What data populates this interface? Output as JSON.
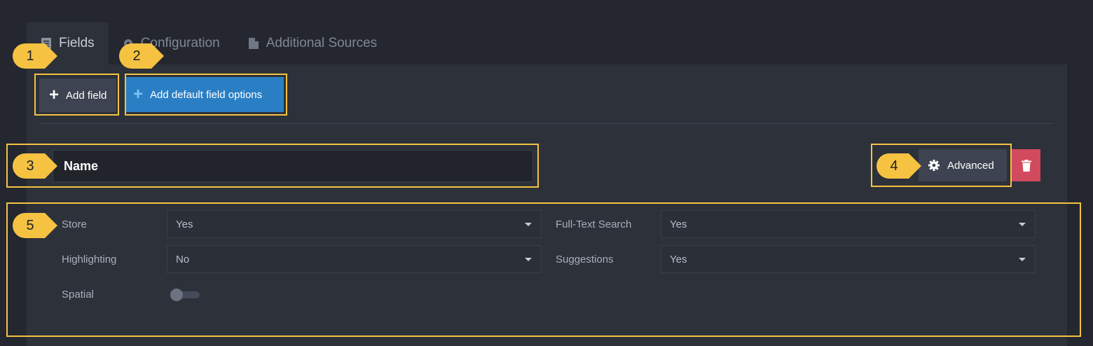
{
  "tabs": [
    {
      "label": "Fields",
      "icon": "list-icon",
      "active": true
    },
    {
      "label": "Configuration",
      "icon": "gear-icon",
      "active": false
    },
    {
      "label": "Additional Sources",
      "icon": "csharp-file-icon",
      "active": false
    }
  ],
  "toolbar": {
    "add_field_label": "Add field",
    "add_default_label": "Add default field options"
  },
  "field": {
    "name_value": "Name",
    "advanced_label": "Advanced"
  },
  "options": {
    "store_label": "Store",
    "store_value": "Yes",
    "fulltext_label": "Full-Text Search",
    "fulltext_value": "Yes",
    "highlighting_label": "Highlighting",
    "highlighting_value": "No",
    "suggestions_label": "Suggestions",
    "suggestions_value": "Yes",
    "spatial_label": "Spatial",
    "spatial_on": false
  },
  "callouts": [
    "1",
    "2",
    "3",
    "4",
    "5"
  ],
  "colors": {
    "highlight": "#f5c242",
    "primary": "#2a7fc4",
    "danger": "#d14a5e"
  }
}
